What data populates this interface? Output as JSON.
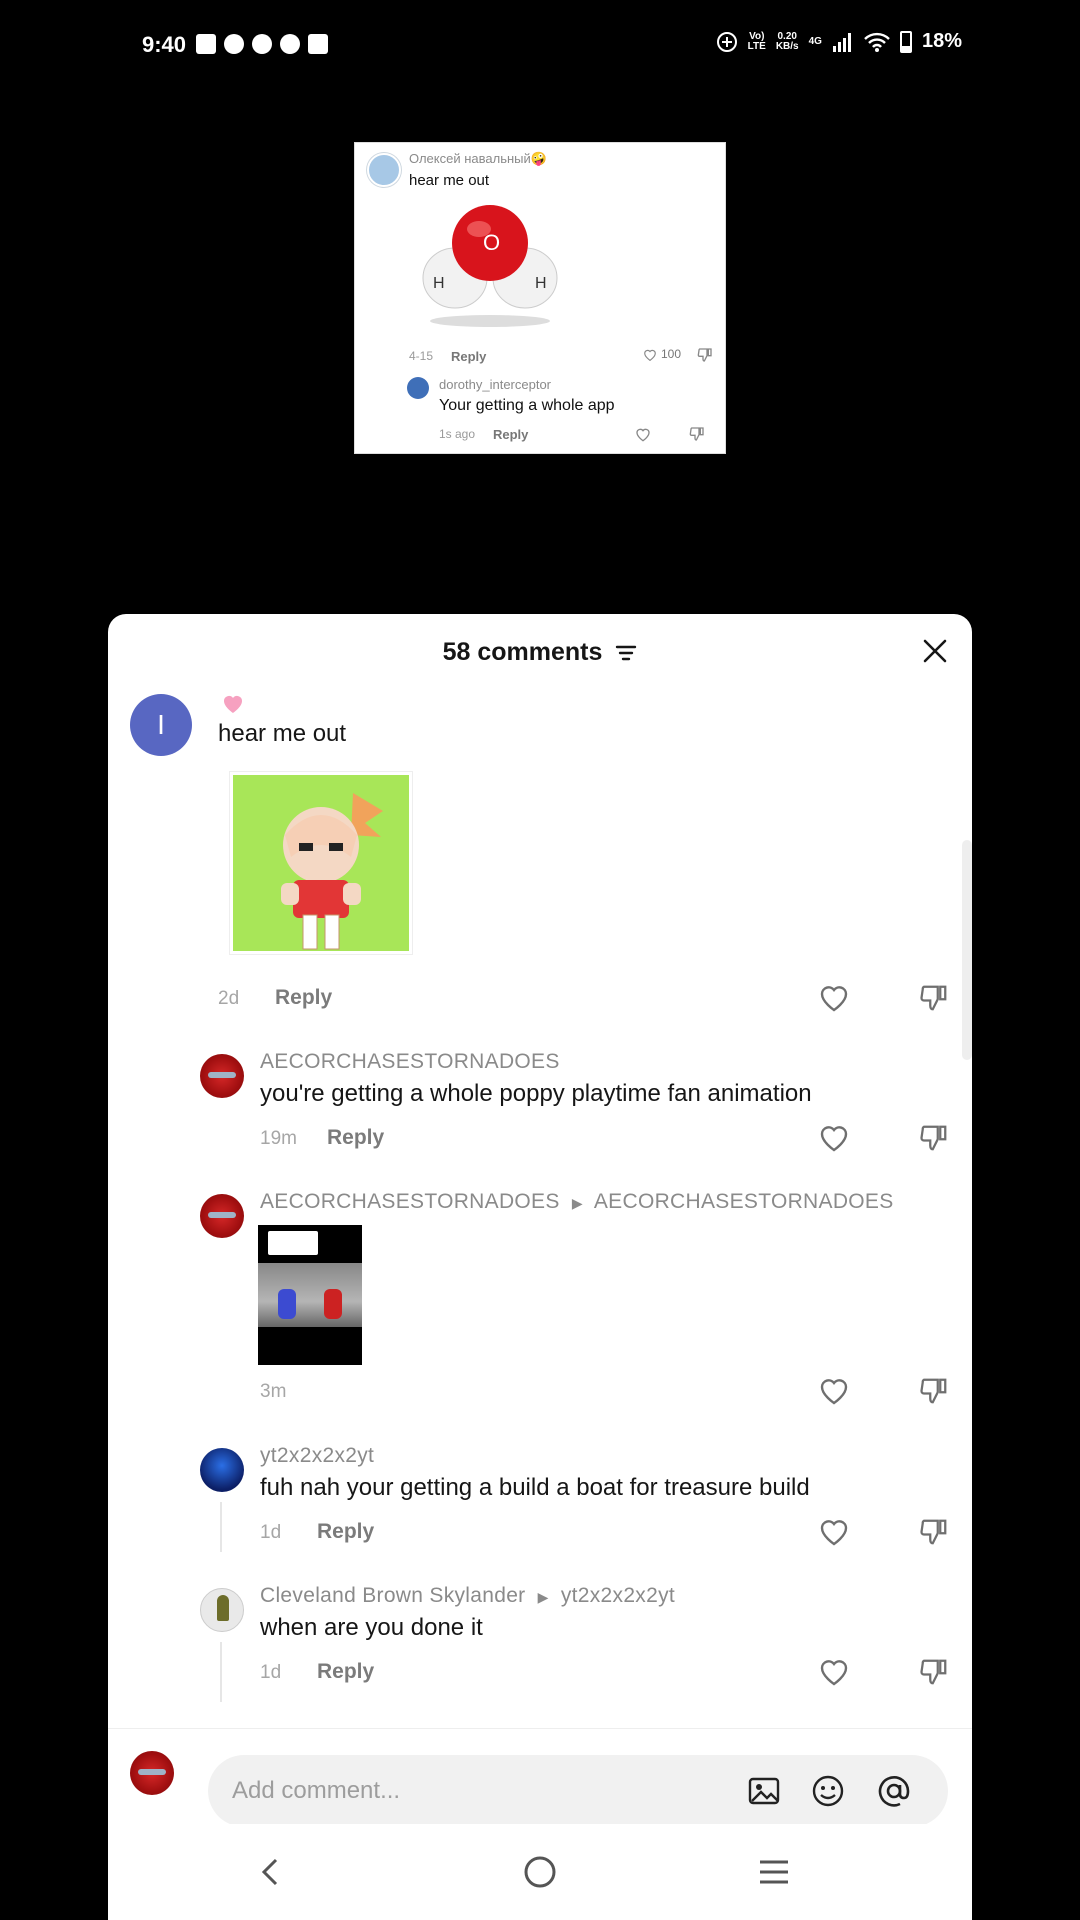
{
  "status_bar": {
    "time": "9:40",
    "net_speed_top": "0.20",
    "net_speed_bottom": "KB/s",
    "volte_top": "Vo)",
    "volte_bottom": "LTE",
    "network": "4G",
    "battery": "18%"
  },
  "preview_card": {
    "username": "Олексей навальный🤪",
    "text": "hear me out",
    "date": "4-15",
    "reply_label": "Reply",
    "like_count": "100",
    "reply_user": "dorothy_interceptor",
    "reply_text": "Your getting a whole app",
    "reply_time": "1s ago",
    "reply_reply_label": "Reply"
  },
  "sheet": {
    "title": "58 comments",
    "comments": [
      {
        "username": "",
        "avatar_letter": "I",
        "text": "hear me out",
        "time": "2d",
        "reply_label": "Reply"
      },
      {
        "username": "AECORCHASESTORNADOES",
        "text": "you're getting a whole poppy playtime fan animation",
        "time": "19m",
        "reply_label": "Reply"
      },
      {
        "username": "AECORCHASESTORNADOES",
        "reply_to": "AECORCHASESTORNADOES",
        "time": "3m"
      },
      {
        "username": "yt2x2x2x2yt",
        "text": "fuh nah your getting a build a boat for treasure build",
        "time": "1d",
        "reply_label": "Reply"
      },
      {
        "username": "Cleveland Brown Skylander",
        "reply_to": "yt2x2x2x2yt",
        "text": "when are you done it",
        "time": "1d",
        "reply_label": "Reply"
      }
    ],
    "composer_placeholder": "Add comment..."
  },
  "colors": {
    "accent_heart": "#f6a1c0",
    "avatar_main": "#5867c2",
    "sheet_bg": "#ffffff"
  }
}
